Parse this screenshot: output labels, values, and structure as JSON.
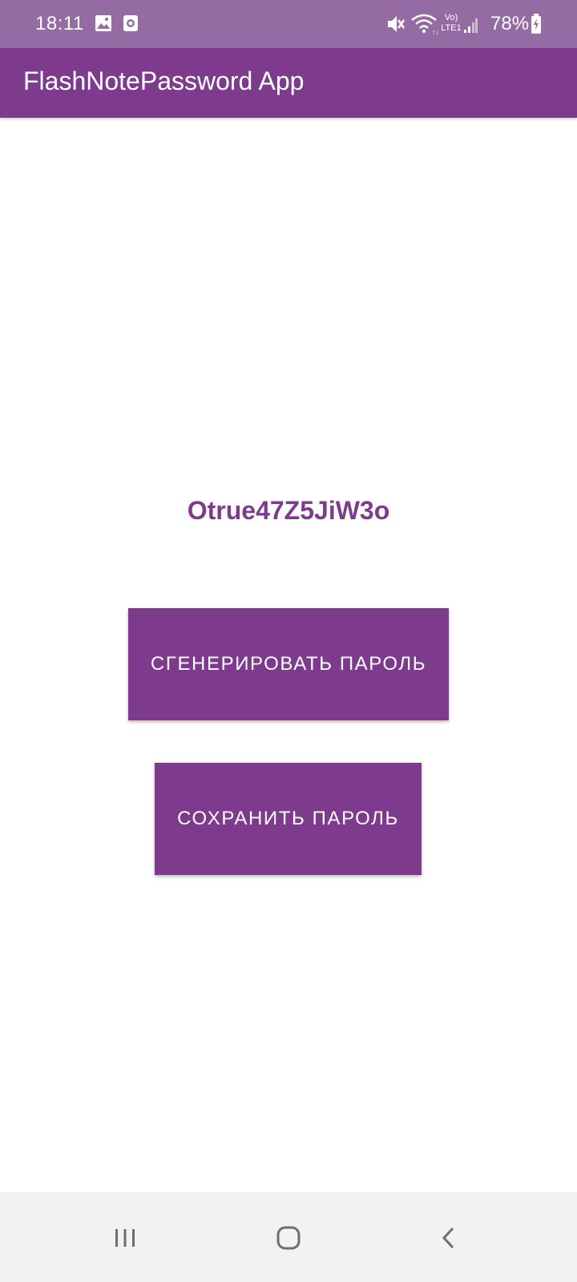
{
  "status_bar": {
    "time": "18:11",
    "battery_percent": "78%",
    "icons": [
      "gallery-icon",
      "screen-record-icon",
      "mute-icon",
      "wifi-icon",
      "volte-lte-icon",
      "signal-icon",
      "battery-charging-icon"
    ],
    "volte_label": "Vo)",
    "lte_label": "LTE1"
  },
  "app_bar": {
    "title": "FlashNotePassword App"
  },
  "main": {
    "password": "Otrue47Z5JiW3o",
    "generate_button_label": "СГЕНЕРИРОВАТЬ ПАРОЛЬ",
    "save_button_label": "СОХРАНИТЬ ПАРОЛЬ"
  },
  "nav_bar": {
    "icons": [
      "recent-apps-icon",
      "home-icon",
      "back-icon"
    ]
  },
  "colors": {
    "primary": "#7e3b8e",
    "status_bar": "#956ba3",
    "nav_bar": "#f2f2f2",
    "background": "#ffffff"
  }
}
